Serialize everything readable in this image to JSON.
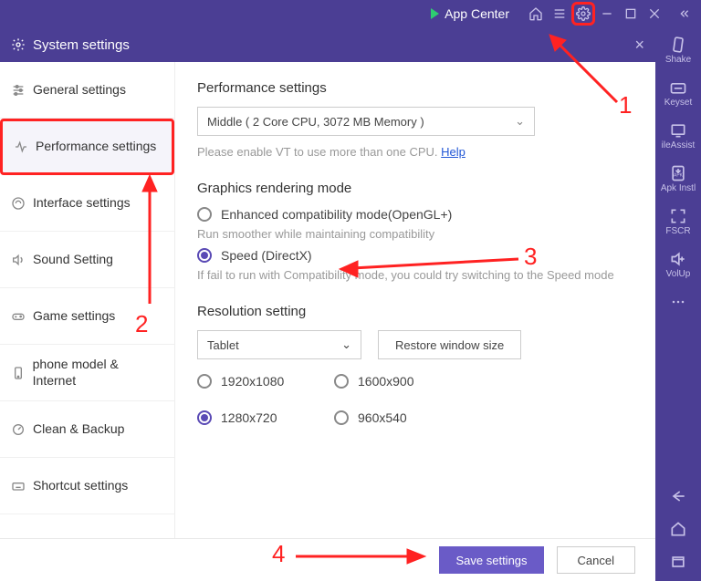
{
  "topbar": {
    "appcenter_label": "App Center"
  },
  "rightbar": {
    "shake": "Shake",
    "keyset": "Keyset",
    "ileassist": "ileAssist",
    "apkinstl": "Apk Instl",
    "fscr": "FSCR",
    "volup": "VolUp"
  },
  "window": {
    "title": "System settings"
  },
  "sidebar": {
    "items": [
      {
        "label": "General settings"
      },
      {
        "label": "Performance settings"
      },
      {
        "label": "Interface settings"
      },
      {
        "label": "Sound Setting"
      },
      {
        "label": "Game settings"
      },
      {
        "label": "phone model & Internet"
      },
      {
        "label": "Clean & Backup"
      },
      {
        "label": "Shortcut settings"
      }
    ]
  },
  "perf": {
    "section_title": "Performance settings",
    "preset_value": "Middle ( 2 Core CPU, 3072 MB Memory )",
    "vt_hint_pre": "Please enable VT to use more than one CPU. ",
    "vt_help": "Help"
  },
  "graphics": {
    "section_title": "Graphics rendering mode",
    "opt_enhanced": "Enhanced compatibility mode(OpenGL+)",
    "enhanced_hint": "Run smoother while maintaining compatibility",
    "opt_speed": "Speed (DirectX)",
    "speed_hint": " If fail to run with Compatibility mode, you could try switching to the Speed mode"
  },
  "resolution": {
    "section_title": "Resolution setting",
    "preset": "Tablet",
    "restore_label": "Restore window size",
    "opts": [
      "1920x1080",
      "1600x900",
      "1280x720",
      "960x540"
    ],
    "selected": "1280x720"
  },
  "footer": {
    "save": "Save settings",
    "cancel": "Cancel"
  },
  "annotations": {
    "n1": "1",
    "n2": "2",
    "n3": "3",
    "n4": "4"
  }
}
